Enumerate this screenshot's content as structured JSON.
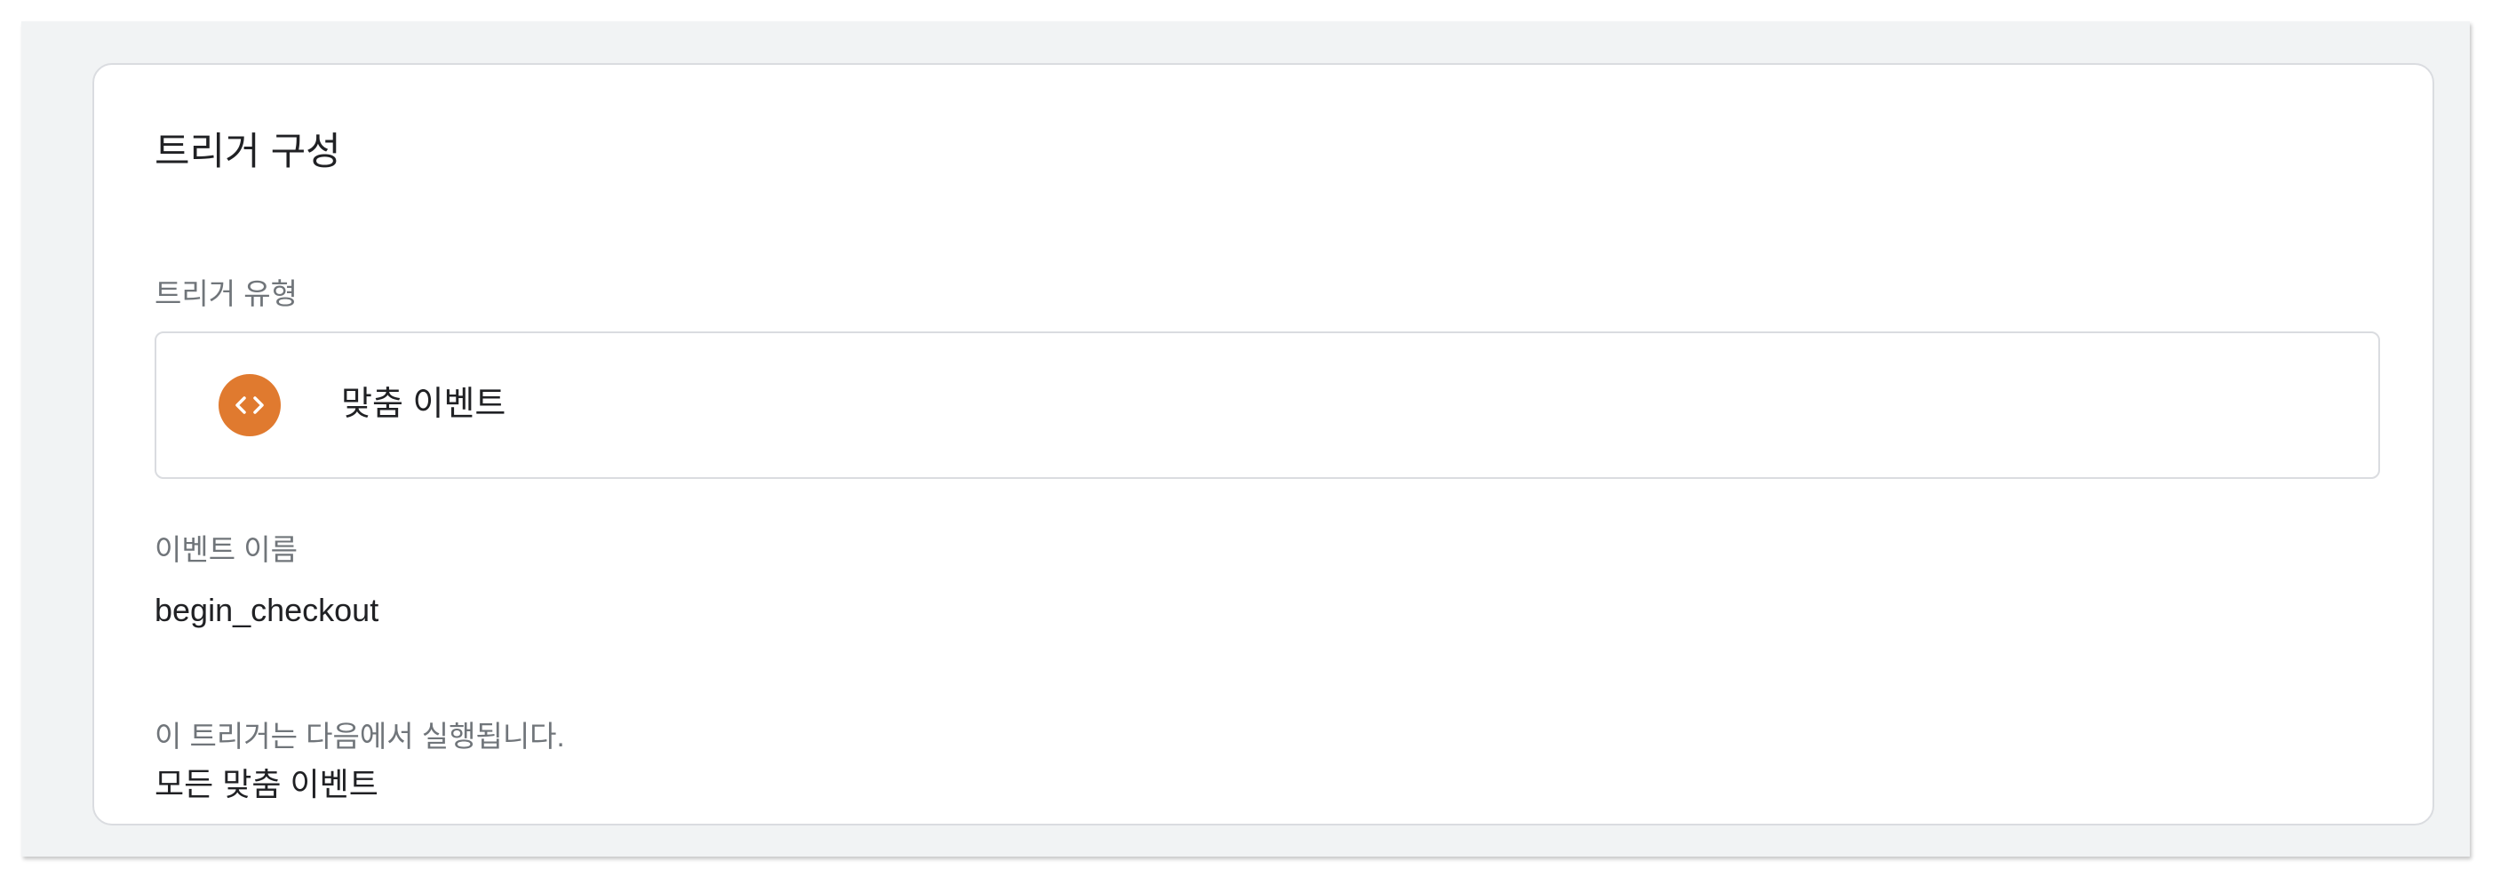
{
  "trigger_config": {
    "title": "트리거 구성",
    "type_label": "트리거 유형",
    "type_value": "맞춤 이벤트",
    "type_icon": "code-brackets-icon",
    "type_icon_color": "#e07a2f",
    "event_name_label": "이벤트 이름",
    "event_name_value": "begin_checkout",
    "fires_on_label": "이 트리거는 다음에서 실행됩니다.",
    "fires_on_value": "모든 맞춤 이벤트"
  }
}
